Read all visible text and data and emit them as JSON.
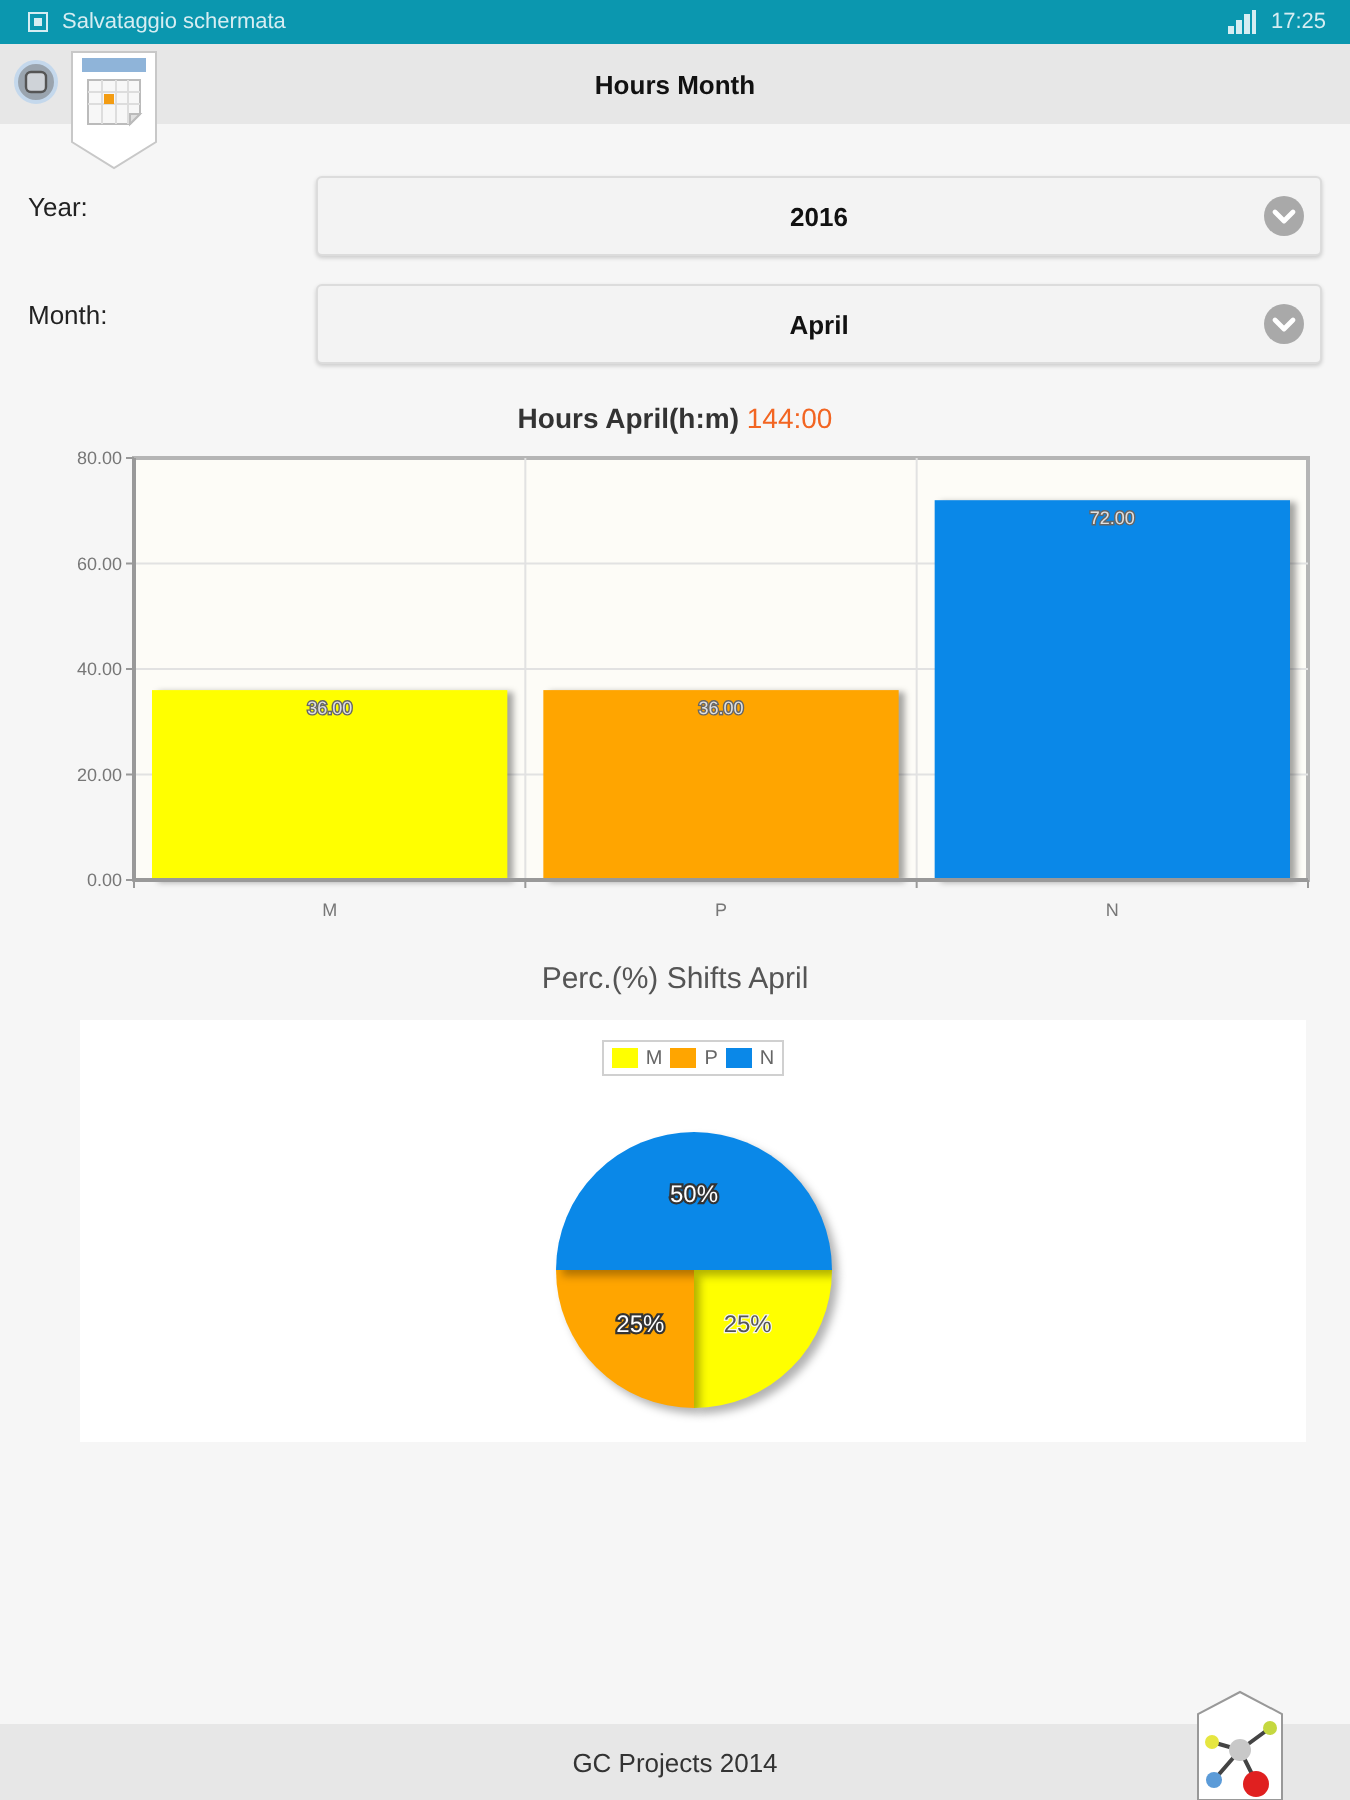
{
  "status_bar": {
    "notification": "Salvataggio schermata",
    "time": "17:25"
  },
  "header": {
    "title": "Hours Month"
  },
  "filters": [
    {
      "label": "Year:",
      "value": "2016"
    },
    {
      "label": "Month:",
      "value": "April"
    }
  ],
  "hours_chart": {
    "title": "Hours April(h:m)",
    "total": "144:00",
    "chart_data": {
      "type": "bar",
      "categories": [
        "M",
        "P",
        "N"
      ],
      "values": [
        36,
        36,
        72
      ],
      "colors": [
        "#ffff00",
        "#ffa500",
        "#0a88e8"
      ],
      "grid": true,
      "ylim": [
        0,
        80
      ],
      "yticks": [
        {
          "value": 0,
          "label": "0.00"
        },
        {
          "value": 20,
          "label": "20.00"
        },
        {
          "value": 40,
          "label": "40.00"
        },
        {
          "value": 60,
          "label": "60.00"
        },
        {
          "value": 80,
          "label": "80.00"
        }
      ],
      "value_labels": [
        "36.00",
        "36.00",
        "72.00"
      ]
    }
  },
  "pie_chart": {
    "chart_data": {
      "type": "pie",
      "title": "Perc.(%) Shifts April",
      "categories": [
        "M",
        "P",
        "N"
      ],
      "values": [
        25,
        25,
        50
      ],
      "colors": [
        "#ffff00",
        "#ffa500",
        "#0a88e8"
      ],
      "legend": true,
      "value_labels": [
        "25%",
        "25%",
        "50%"
      ]
    }
  },
  "footer": {
    "text": "GC Projects 2014"
  }
}
